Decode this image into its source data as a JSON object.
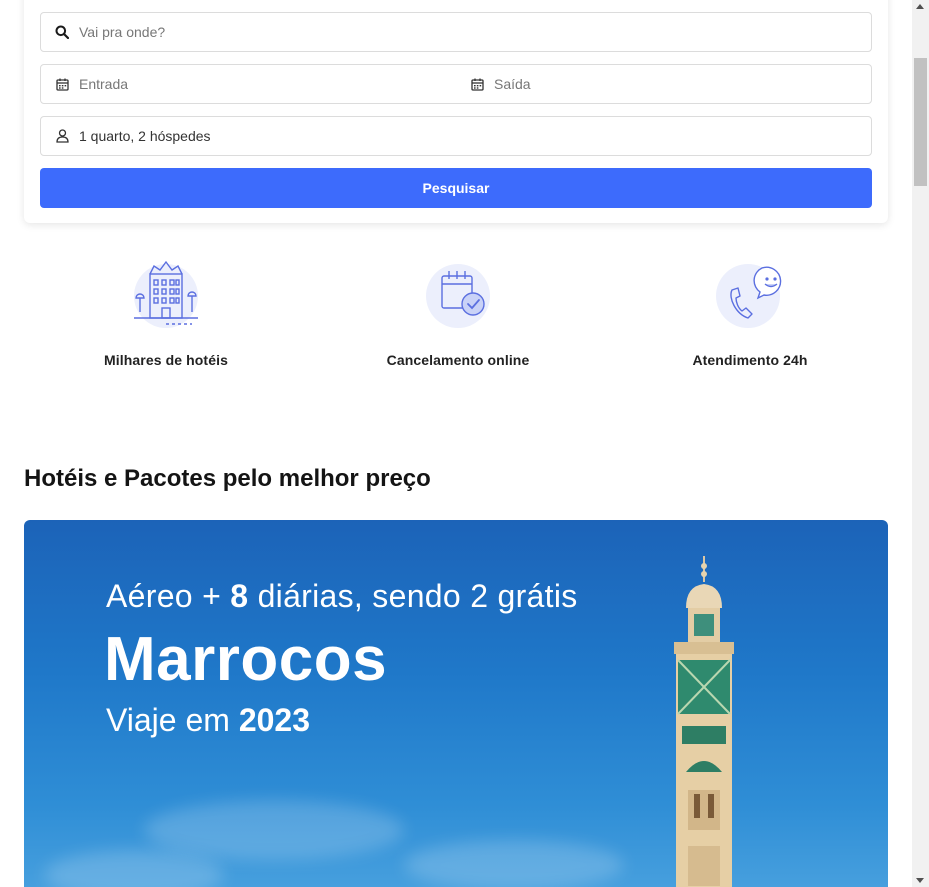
{
  "search": {
    "destination_placeholder": "Vai pra onde?",
    "checkin_placeholder": "Entrada",
    "checkout_placeholder": "Saída",
    "guests_value": "1 quarto, 2 hóspedes",
    "submit_label": "Pesquisar"
  },
  "features": [
    {
      "label": "Milhares de hotéis",
      "icon": "hotel-building-icon"
    },
    {
      "label": "Cancelamento online",
      "icon": "calendar-check-icon"
    },
    {
      "label": "Atendimento 24h",
      "icon": "phone-chat-icon"
    }
  ],
  "section": {
    "title": "Hotéis e Pacotes pelo melhor preço"
  },
  "banner": {
    "line1_prefix": "Aéreo + ",
    "line1_bold": "8",
    "line1_suffix": " diárias, sendo 2 grátis",
    "line2": "Marrocos",
    "line3_prefix": "Viaje em ",
    "line3_bold": "2023"
  },
  "colors": {
    "accent": "#3d6bfc",
    "illustration": "#5b6fe0",
    "illustration_bg": "#eceffc"
  }
}
